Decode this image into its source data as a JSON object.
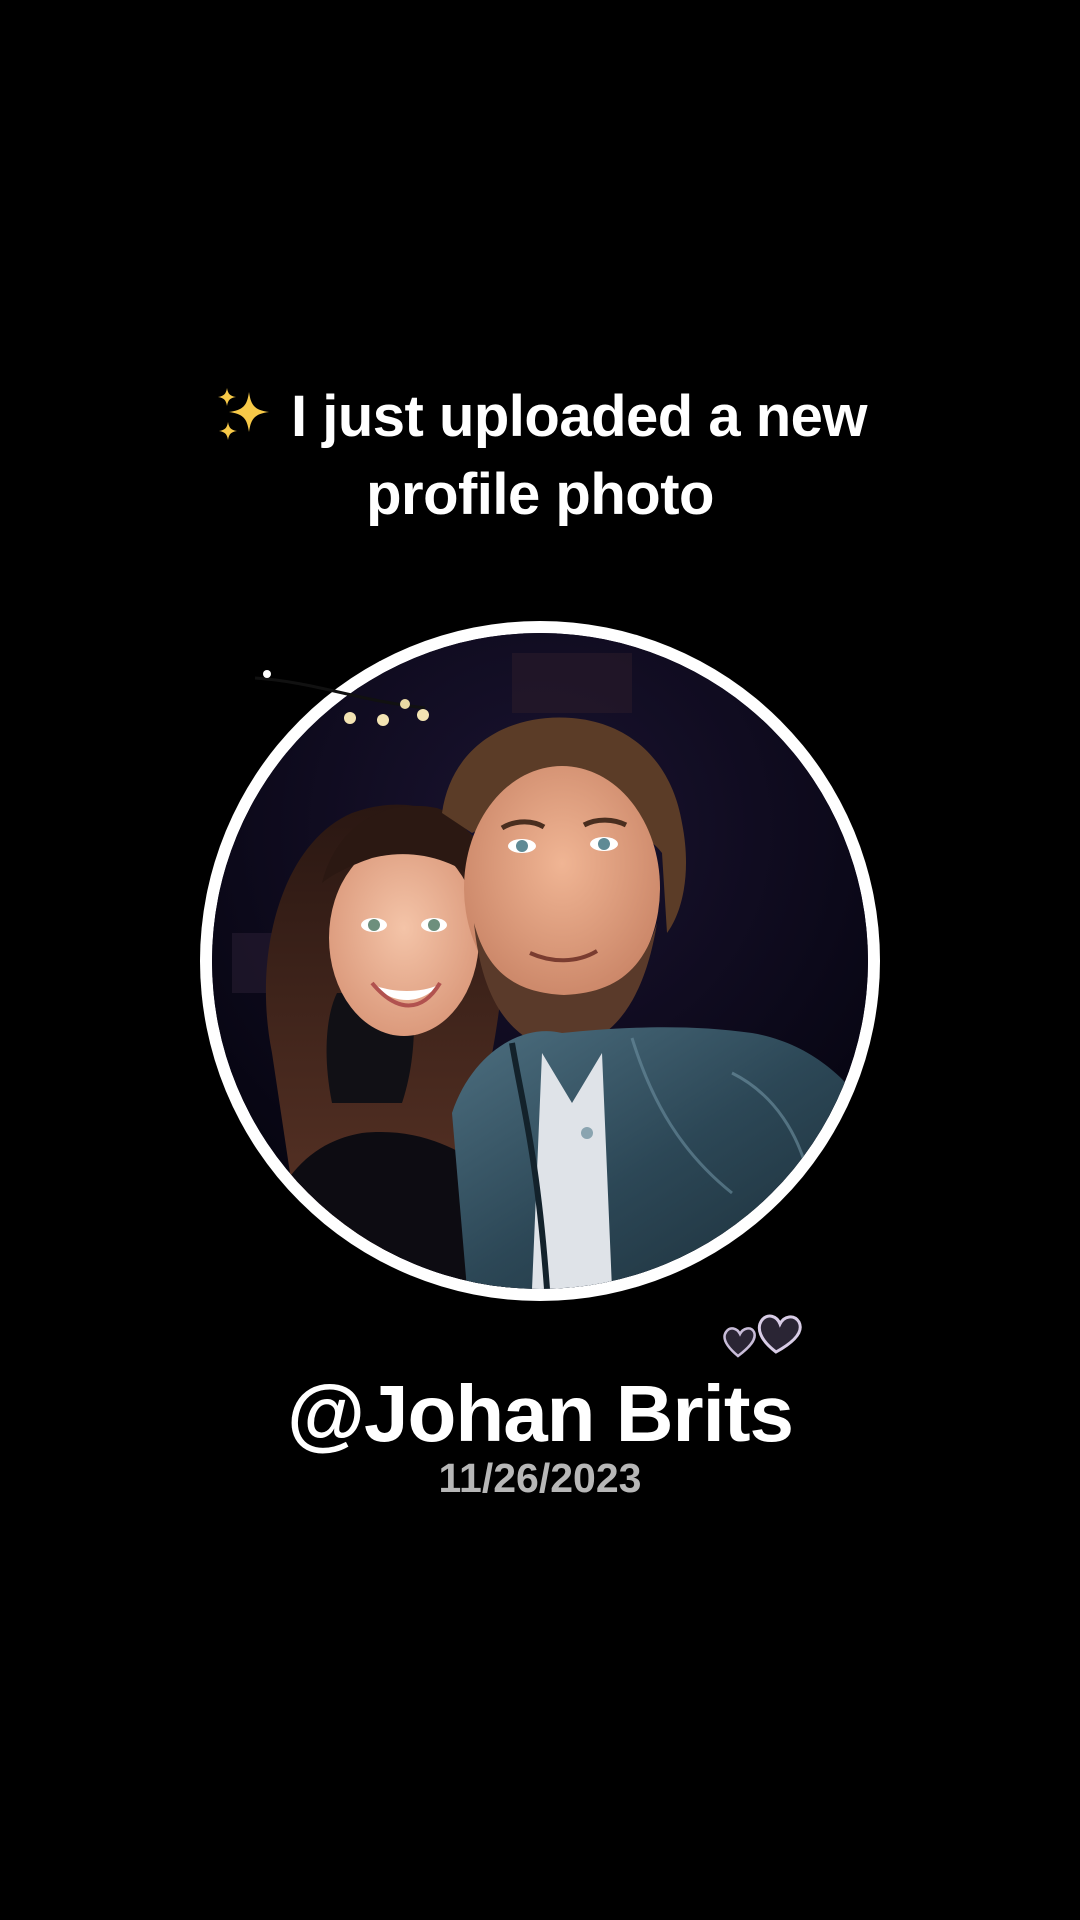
{
  "post": {
    "headline_line1": "I just uploaded a new",
    "headline_line2": "profile photo",
    "headline_icon": "sparkles-icon",
    "username": "@Johan Brits",
    "date": "11/26/2023",
    "decoration_icon": "two-hearts-icon",
    "photo_description_icon": "profile-photo"
  },
  "colors": {
    "background": "#000000",
    "text": "#ffffff",
    "date_text": "#b7b7b7",
    "avatar_ring": "#ffffff"
  }
}
